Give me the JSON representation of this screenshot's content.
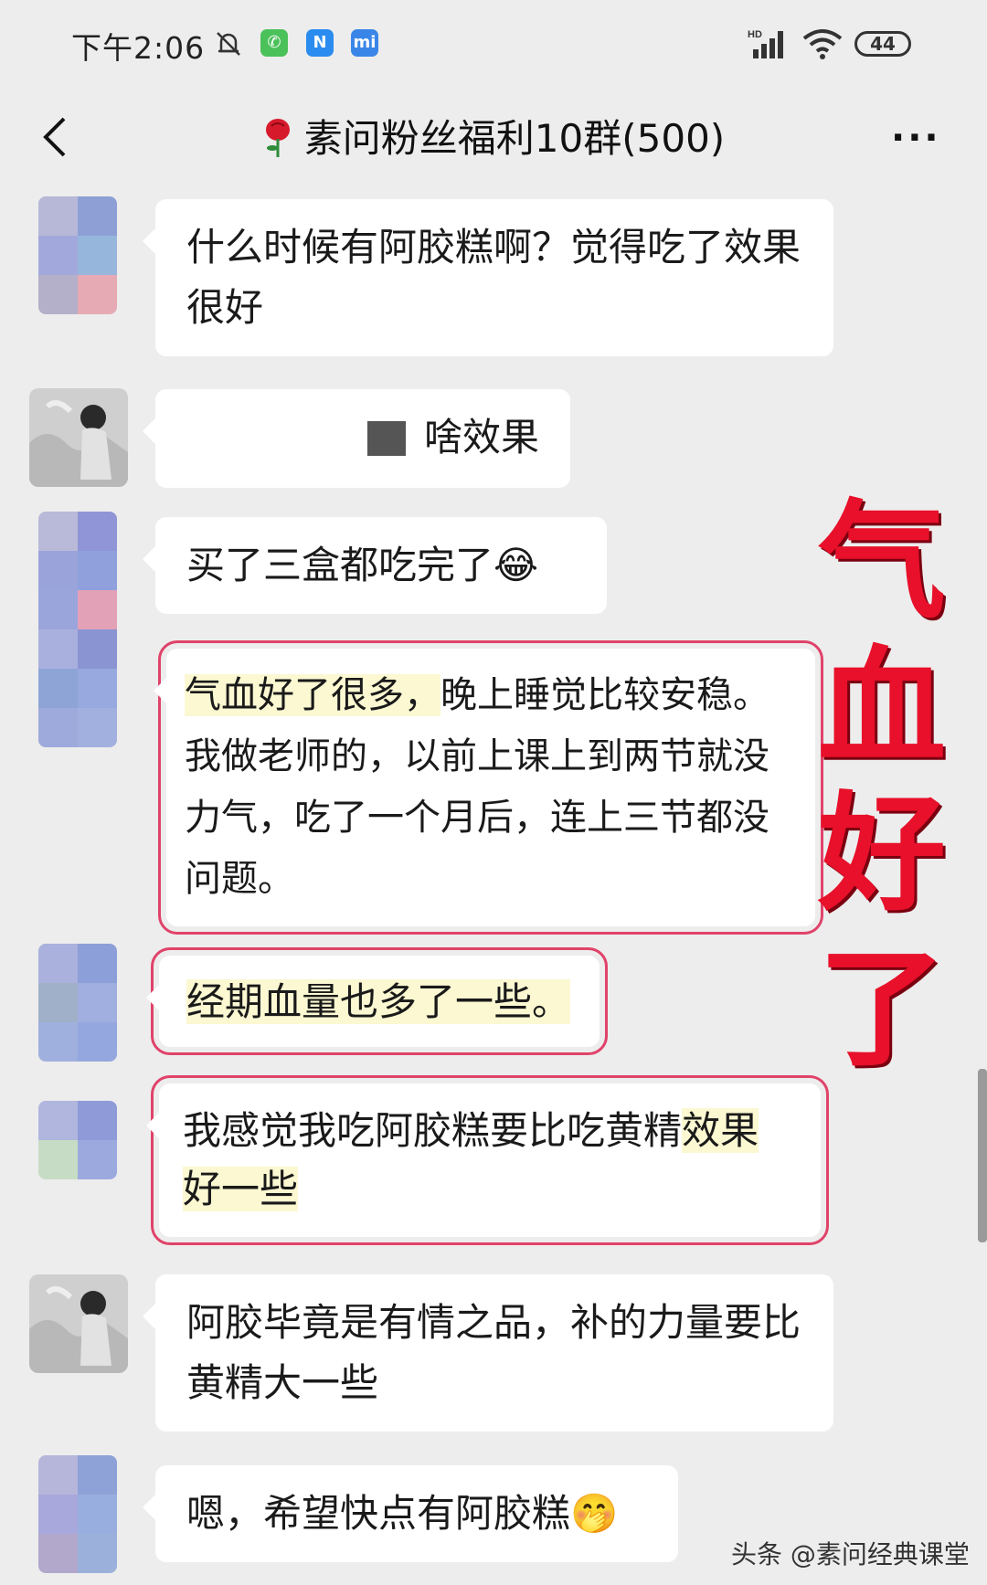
{
  "status_bar": {
    "time": "下午2:06",
    "battery": "44",
    "signal_label": "HD"
  },
  "nav": {
    "title": "素问粉丝福利10群(500)",
    "more": "···"
  },
  "messages": [
    {
      "text": "什么时候有阿胶糕啊？觉得吃了效果很好"
    },
    {
      "text": "啥效果"
    },
    {
      "text": "买了三盒都吃完了😂"
    },
    {
      "hl": "气血好了很多，",
      "text": "晚上睡觉比较安稳。我做老师的，以前上课上到两节就没力气，吃了一个月后，连上三节都没问题。"
    },
    {
      "hl": "经期血量也多了一些。"
    },
    {
      "text": "我感觉我吃阿胶糕要比吃黄精",
      "hl": "效果好一些"
    },
    {
      "text": "阿胶毕竟是有情之品，补的力量要比黄精大一些"
    },
    {
      "text": "嗯，希望快点有阿胶糕🤭"
    }
  ],
  "overlay_chars": [
    "气",
    "血",
    "好",
    "了"
  ],
  "watermark": "头条 @素问经典课堂",
  "colors": {
    "background": "#ededed",
    "highlight_box": "#e0436a",
    "overlay_red": "#e8102a"
  }
}
